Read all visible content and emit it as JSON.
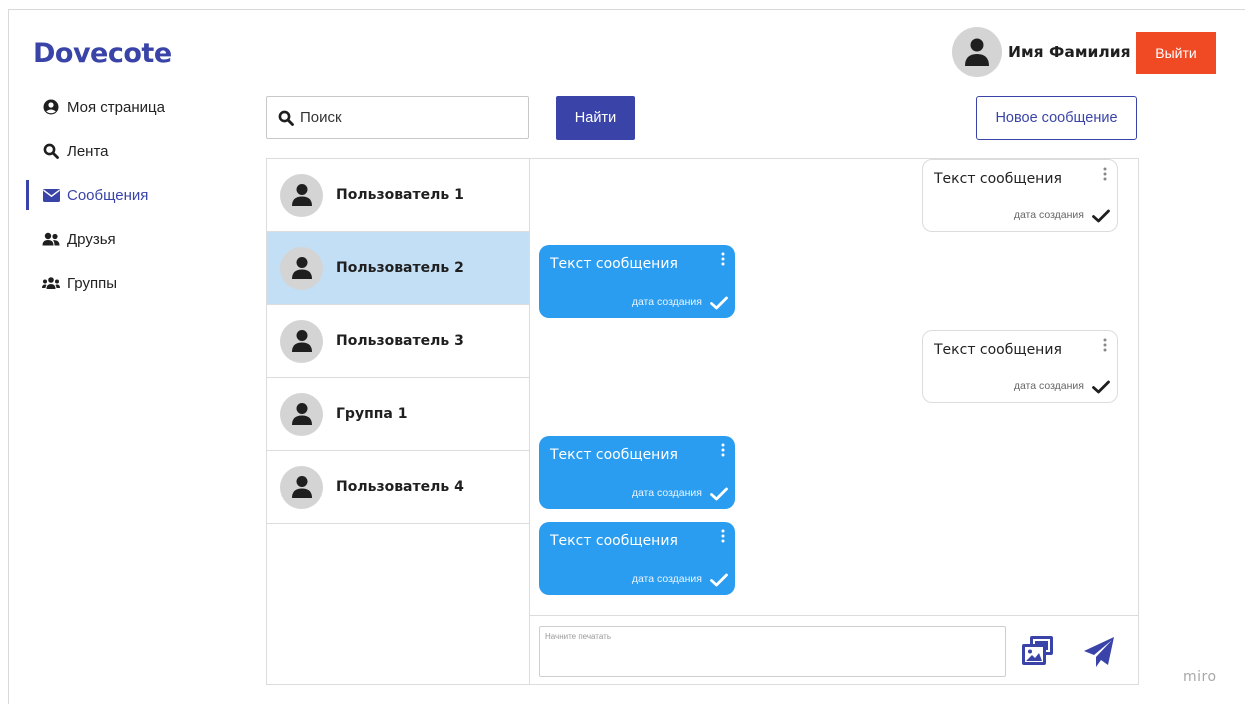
{
  "app": {
    "logo": "Dovecote"
  },
  "user": {
    "name": "Имя Фамилия",
    "logout_label": "Выйти"
  },
  "nav": {
    "items": [
      {
        "label": "Моя страница",
        "icon": "user-circle-icon"
      },
      {
        "label": "Лента",
        "icon": "search-icon"
      },
      {
        "label": "Сообщения",
        "icon": "envelope-icon",
        "active": true
      },
      {
        "label": "Друзья",
        "icon": "user-friends-icon"
      },
      {
        "label": "Группы",
        "icon": "users-group-icon"
      }
    ]
  },
  "toolbar": {
    "search_placeholder": "Поиск",
    "find_label": "Найти",
    "new_message_label": "Новое сообщение"
  },
  "contacts": [
    {
      "name": "Пользователь 1",
      "selected": false
    },
    {
      "name": "Пользователь 2",
      "selected": true
    },
    {
      "name": "Пользователь 3",
      "selected": false
    },
    {
      "name": "Группа 1",
      "selected": false
    },
    {
      "name": "Пользователь 4",
      "selected": false
    }
  ],
  "messages": [
    {
      "direction": "out",
      "text": "Текст сообщения",
      "date": "дата создания"
    },
    {
      "direction": "in",
      "text": "Текст сообщения",
      "date": "дата создания"
    },
    {
      "direction": "out",
      "text": "Текст сообщения",
      "date": "дата создания"
    },
    {
      "direction": "in",
      "text": "Текст сообщения",
      "date": "дата создания"
    },
    {
      "direction": "in",
      "text": "Текст сообщения",
      "date": "дата создания"
    }
  ],
  "composer": {
    "placeholder": "Начните печатать"
  },
  "watermark": "miro",
  "colors": {
    "brand": "#3a44a8",
    "logout": "#f04a25",
    "incoming_bubble": "#2b9df0",
    "selected_contact": "#c3dff5"
  }
}
